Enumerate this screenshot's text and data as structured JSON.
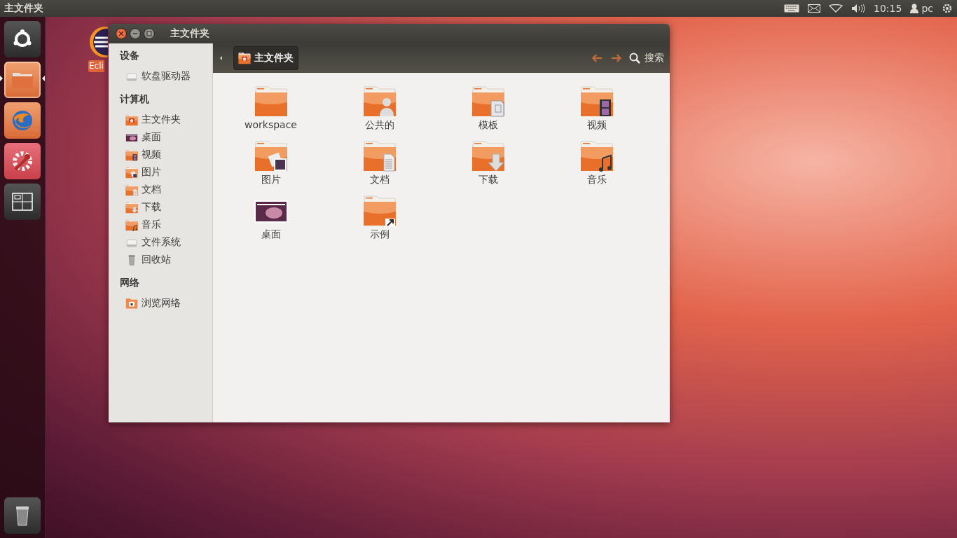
{
  "top_panel": {
    "title": "主文件夹",
    "clock": "10:15",
    "user": "pc"
  },
  "launcher": [
    {
      "kind": "dash",
      "running": false
    },
    {
      "kind": "files",
      "running": true
    },
    {
      "kind": "browser",
      "running": false
    },
    {
      "kind": "settings",
      "running": false
    },
    {
      "kind": "workspaces",
      "running": false
    },
    {
      "kind": "trash",
      "running": false
    }
  ],
  "desktop_icon": {
    "label": "Ecli"
  },
  "window": {
    "title": "主文件夹"
  },
  "sidebar": [
    {
      "heading": "设备",
      "items": [
        {
          "label": "软盘驱动器",
          "kind": "drive"
        }
      ]
    },
    {
      "heading": "计算机",
      "items": [
        {
          "label": "主文件夹",
          "kind": "home"
        },
        {
          "label": "桌面",
          "kind": "desktop"
        },
        {
          "label": "视频",
          "kind": "video"
        },
        {
          "label": "图片",
          "kind": "pictures"
        },
        {
          "label": "文档",
          "kind": "documents"
        },
        {
          "label": "下载",
          "kind": "download"
        },
        {
          "label": "音乐",
          "kind": "music"
        },
        {
          "label": "文件系统",
          "kind": "drive"
        },
        {
          "label": "回收站",
          "kind": "trash"
        }
      ]
    },
    {
      "heading": "网络",
      "items": [
        {
          "label": "浏览网络",
          "kind": "network"
        }
      ]
    }
  ],
  "toolbar": {
    "location": "主文件夹",
    "search": "搜索"
  },
  "files": [
    {
      "label": "workspace",
      "kind": "folder"
    },
    {
      "label": "公共的",
      "kind": "public"
    },
    {
      "label": "模板",
      "kind": "templates"
    },
    {
      "label": "视频",
      "kind": "video"
    },
    {
      "label": "图片",
      "kind": "pictures"
    },
    {
      "label": "文档",
      "kind": "documents"
    },
    {
      "label": "下载",
      "kind": "download"
    },
    {
      "label": "音乐",
      "kind": "music"
    },
    {
      "label": "桌面",
      "kind": "desktop"
    },
    {
      "label": "示例",
      "kind": "link"
    }
  ]
}
